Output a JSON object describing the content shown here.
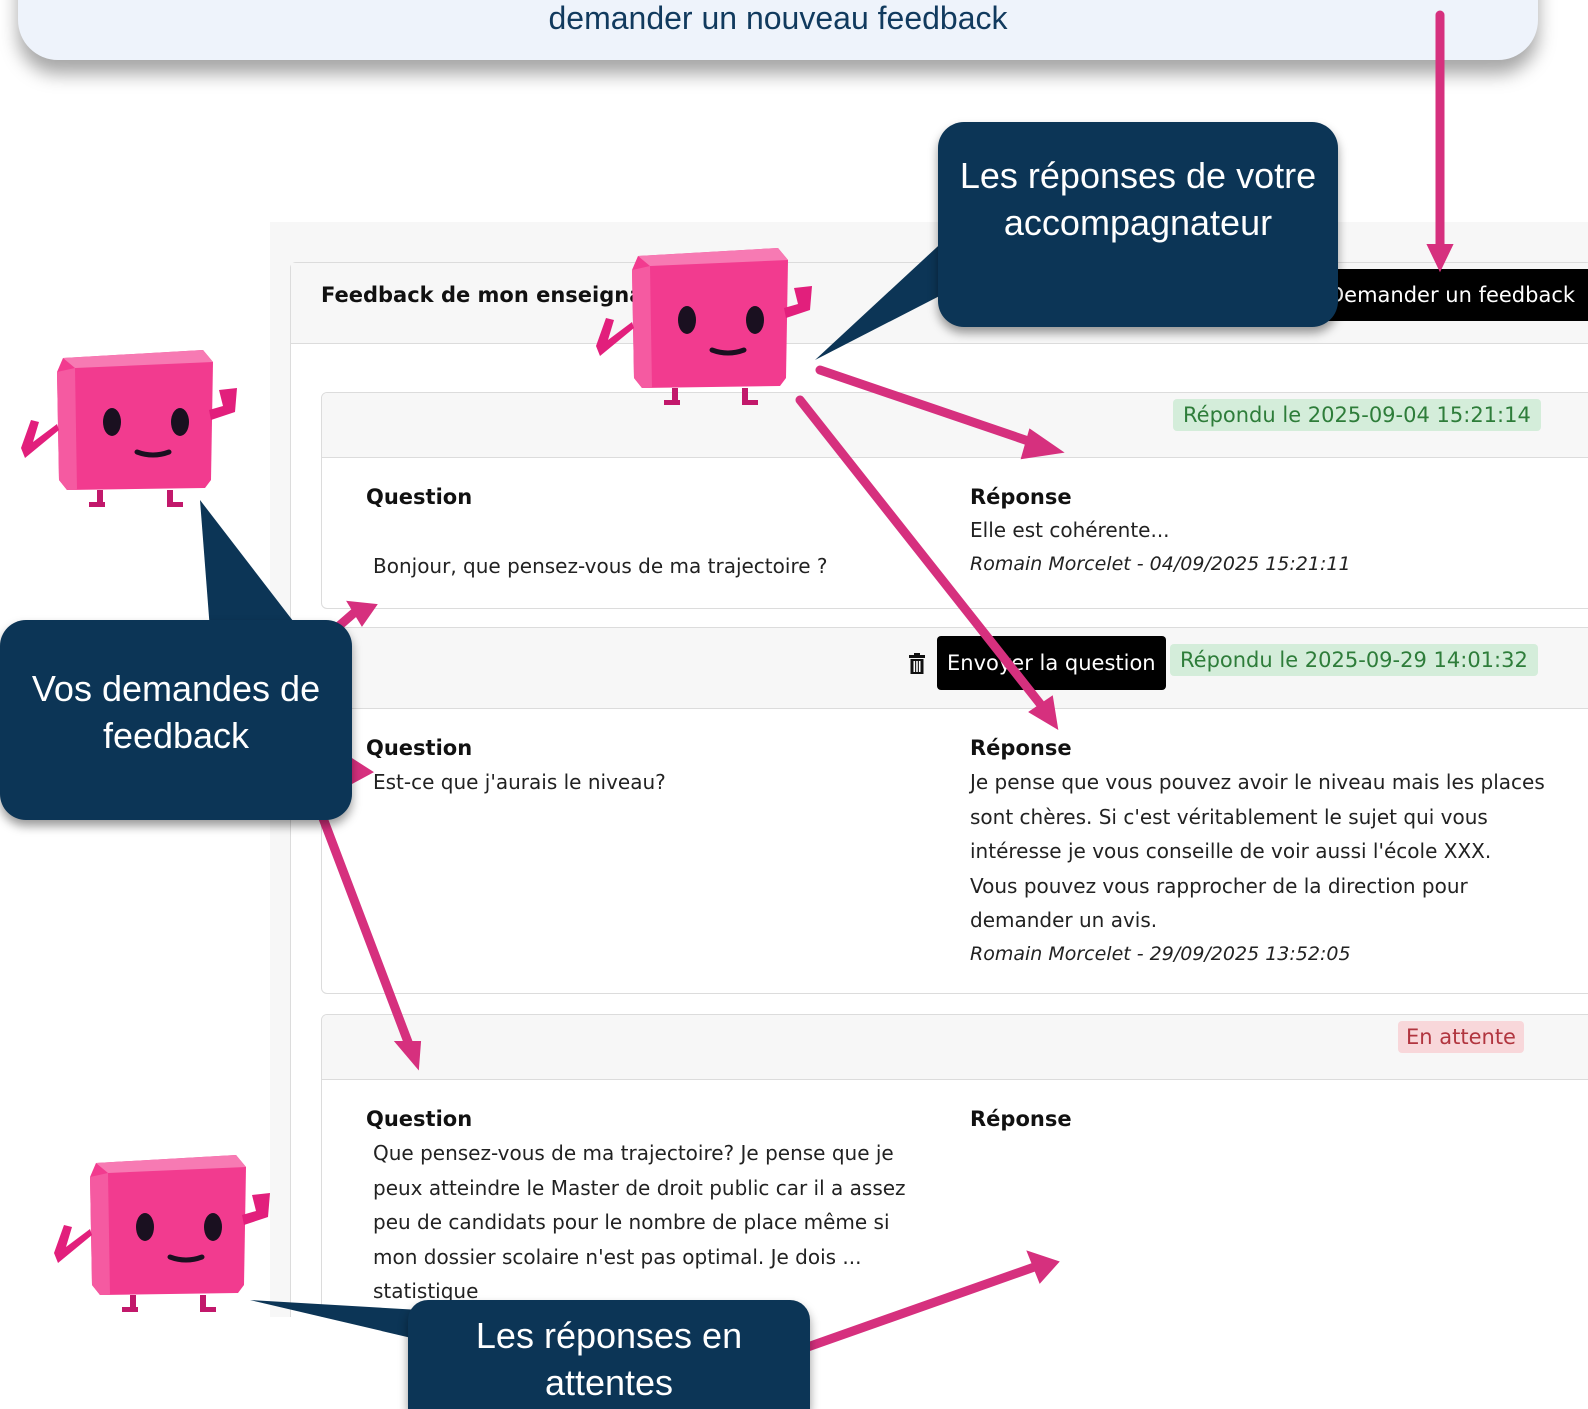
{
  "banner": {
    "text": "demander un nouveau feedback"
  },
  "card": {
    "title": "Feedback de mon enseignant",
    "request_button": "Demander un feedback"
  },
  "labels": {
    "question": "Question",
    "answer": "Réponse"
  },
  "feedbacks": [
    {
      "status": "Répondu le 2025-09-04 15:21:14",
      "question": "Bonjour, que pensez-vous de ma trajectoire ?",
      "answer": "Elle est cohérente...",
      "author": "Romain Morcelet - 04/09/2025 15:21:11"
    },
    {
      "status": "Répondu le 2025-09-29 14:01:32",
      "send_button": "Envoyer la question",
      "question": "Est-ce que j'aurais le niveau?",
      "answer": "Je pense que vous pouvez avoir le niveau mais les places sont chères. Si c'est véritablement le sujet qui vous intéresse je vous conseille de voir aussi l'école XXX. Vous pouvez vous rapprocher de la direction pour demander un avis.",
      "author": "Romain Morcelet - 29/09/2025 13:52:05"
    },
    {
      "status": "En attente",
      "question": "Que pensez-vous de ma trajectoire? Je pense que je peux atteindre le Master de droit public car il a assez peu de candidats pour le nombre de place même si mon dossier scolaire n'est pas optimal. Je dois ... statistique",
      "answer": ""
    }
  ],
  "callouts": {
    "teacher_answers": "Les réponses de votre accompagnateur",
    "your_requests": "Vos demandes de feedback",
    "pending_answers": "Les réponses en attentes"
  },
  "colors": {
    "arrow": "#d6307e",
    "callout_bg": "#0c3556",
    "mascot": "#f23b8f",
    "badge_green_bg": "#d4edda",
    "badge_red_bg": "#f8d7da"
  }
}
